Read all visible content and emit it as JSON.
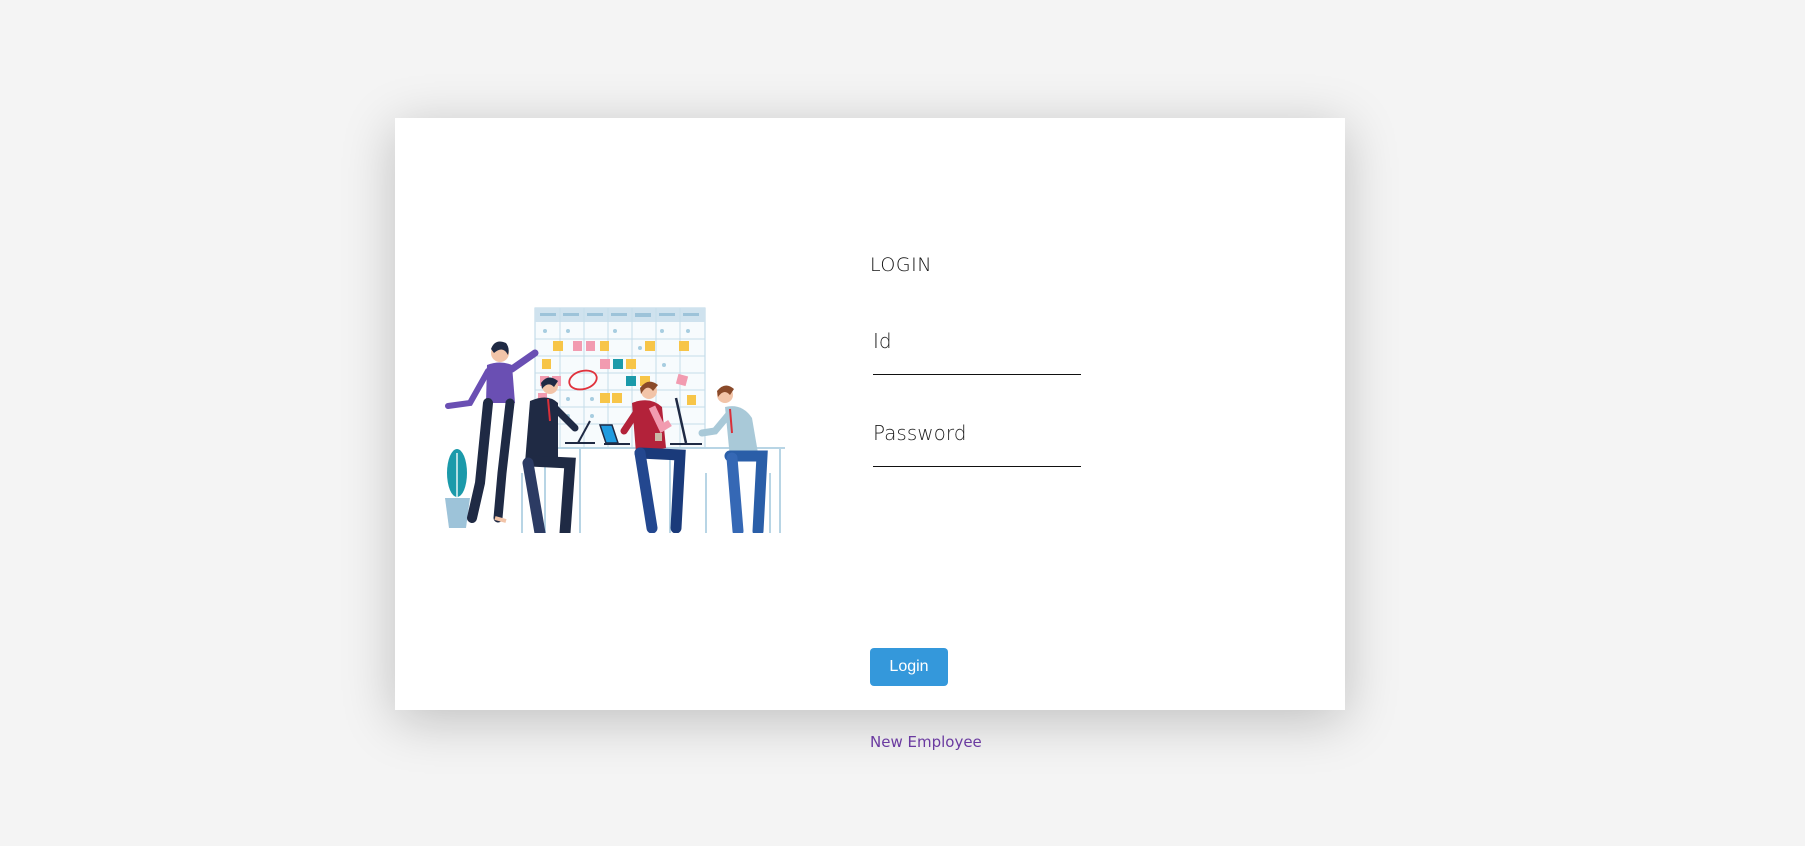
{
  "login": {
    "title": "LOGIN",
    "id_label": "Id",
    "id_value": "",
    "password_label": "Password",
    "password_value": "",
    "submit_label": "Login",
    "new_employee_link": "New Employee"
  },
  "colors": {
    "page_background": "#f4f4f4",
    "card_background": "#ffffff",
    "button": "#3498db",
    "link": "#6a3aa0"
  },
  "illustration": {
    "icon": "team-meeting-illustration"
  }
}
